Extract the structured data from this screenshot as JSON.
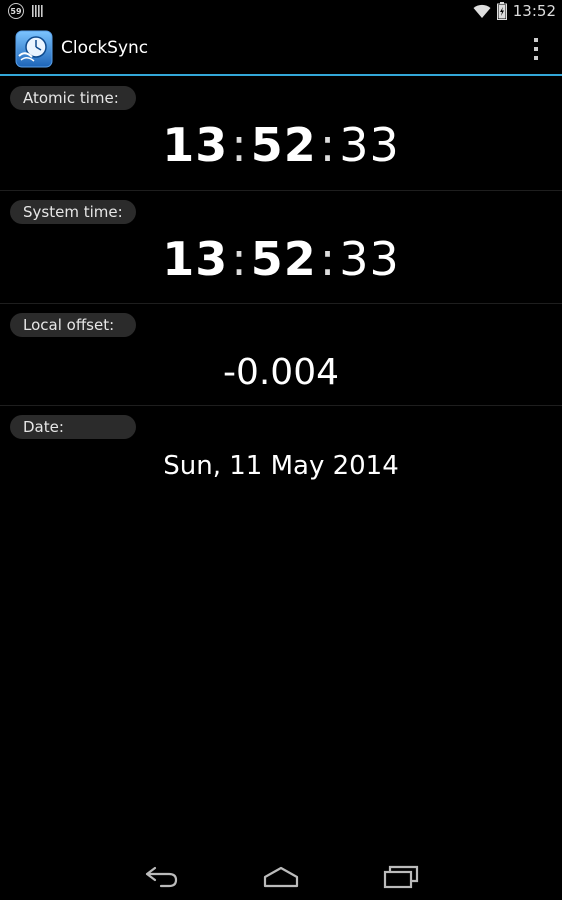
{
  "status_bar": {
    "notification_count": "59",
    "time": "13:52"
  },
  "action_bar": {
    "title": "ClockSync"
  },
  "sections": {
    "atomic": {
      "label": "Atomic time:",
      "hours": "13",
      "minutes": "52",
      "seconds": "33"
    },
    "system": {
      "label": "System time:",
      "hours": "13",
      "minutes": "52",
      "seconds": "33"
    },
    "offset": {
      "label": "Local offset:",
      "value": "-0.004"
    },
    "date": {
      "label": "Date:",
      "value": "Sun, 11 May 2014"
    }
  },
  "time_separator": ":",
  "colors": {
    "accent": "#33a7d8",
    "background": "#000000",
    "pill": "#2b2b2b"
  },
  "icons": {
    "notification": "notification-count-icon",
    "barcode": "barcode-icon",
    "wifi": "wifi-icon",
    "battery": "battery-charging-icon",
    "app": "clocksync-app-icon",
    "overflow": "overflow-menu-icon",
    "back": "back-icon",
    "home": "home-icon",
    "recents": "recent-apps-icon"
  }
}
